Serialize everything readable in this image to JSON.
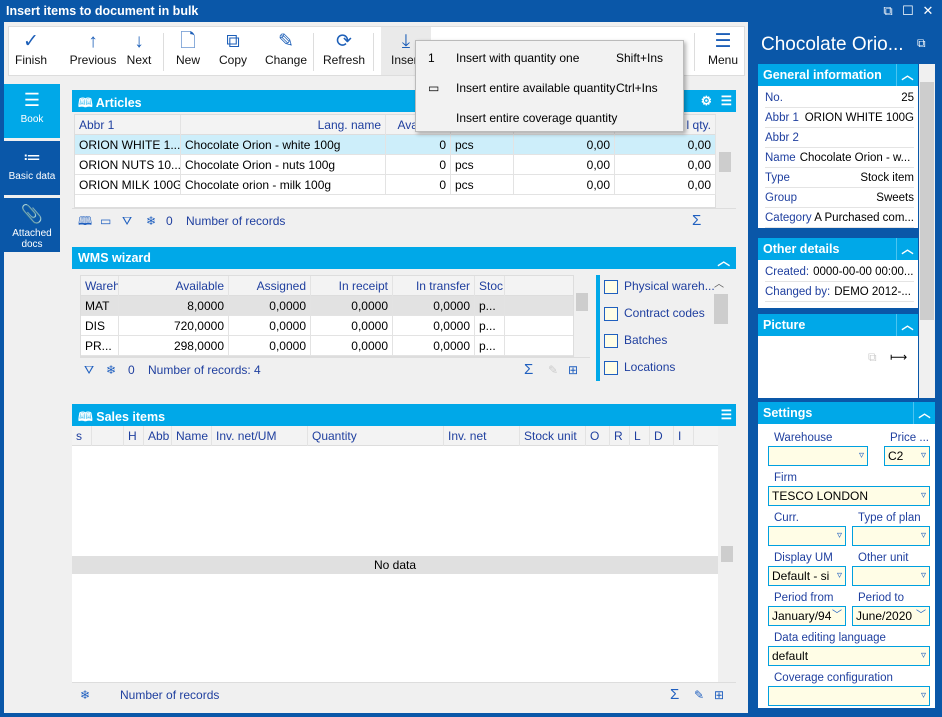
{
  "window": {
    "title": "Insert items to document in bulk"
  },
  "toolbar": {
    "buttons": [
      {
        "label": "Finish",
        "icon": "✓"
      },
      {
        "label": "Previous",
        "icon": "↑"
      },
      {
        "label": "Next",
        "icon": "↓"
      },
      {
        "label": "New",
        "icon": "🗋"
      },
      {
        "label": "Copy",
        "icon": "⧉"
      },
      {
        "label": "Change",
        "icon": "✎"
      },
      {
        "label": "Refresh",
        "icon": "⟳"
      },
      {
        "label": "Insert",
        "icon": "⤓"
      }
    ],
    "menu_label": "Menu"
  },
  "insert_menu": [
    {
      "icon": "1",
      "label": "Insert with quantity one",
      "shortcut": "Shift+Ins"
    },
    {
      "icon": "▭",
      "label": "Insert entire available quantity",
      "shortcut": "Ctrl+Ins"
    },
    {
      "icon": "",
      "label": "Insert entire coverage quantity",
      "shortcut": ""
    }
  ],
  "nav": [
    {
      "label": "Book",
      "icon": "☰"
    },
    {
      "label": "Basic data",
      "icon": "≔"
    },
    {
      "label": "Attached docs",
      "icon": "📎"
    }
  ],
  "articles": {
    "title": "Articles",
    "columns": [
      "Abbr 1",
      "Lang. name",
      "Available",
      "",
      "",
      "l qty."
    ],
    "rows": [
      [
        "ORION WHITE 1...",
        "Chocolate Orion - white 100g",
        "0",
        "pcs",
        "0,00",
        "0,00"
      ],
      [
        "ORION NUTS 10...",
        "Chocolate Orion - nuts 100g",
        "0",
        "pcs",
        "0,00",
        "0,00"
      ],
      [
        "ORION MILK 100G",
        "Chocolate orion - milk 100g",
        "0",
        "pcs",
        "0,00",
        "0,00"
      ]
    ],
    "filter_count": "0",
    "records_label": "Number of records"
  },
  "wms": {
    "title": "WMS wizard",
    "columns": [
      "Wareh",
      "Available",
      "Assigned",
      "In receipt",
      "In transfer",
      "Stoc"
    ],
    "rows": [
      [
        "MAT",
        "8,0000",
        "0,0000",
        "0,0000",
        "0,0000",
        "p..."
      ],
      [
        "DIS",
        "720,0000",
        "0,0000",
        "0,0000",
        "0,0000",
        "p..."
      ],
      [
        "PR...",
        "298,0000",
        "0,0000",
        "0,0000",
        "0,0000",
        "p..."
      ]
    ],
    "filter_count": "0",
    "records_label": "Number of records: 4",
    "options": [
      "Physical wareh...",
      "Contract codes",
      "Batches",
      "Locations"
    ]
  },
  "sales": {
    "title": "Sales items",
    "columns": [
      "s",
      "",
      "H",
      "Abb",
      "Name",
      "Inv. net/UM",
      "Quantity",
      "Inv. net",
      "Stock unit",
      "O",
      "R",
      "L",
      "D",
      "I"
    ],
    "empty": "No data",
    "filter_count": "",
    "records_label": "Number of records"
  },
  "detail": {
    "title": "Chocolate Orio...",
    "general": {
      "title": "General information",
      "fields": [
        {
          "k": "No.",
          "v": "25"
        },
        {
          "k": "Abbr 1",
          "v": "ORION WHITE 100G"
        },
        {
          "k": "Abbr 2",
          "v": ""
        },
        {
          "k": "Name",
          "v": "Chocolate Orion - w..."
        },
        {
          "k": "Type",
          "v": "Stock item"
        },
        {
          "k": "Group",
          "v": "Sweets"
        },
        {
          "k": "Category",
          "v": "A Purchased com..."
        }
      ]
    },
    "other": {
      "title": "Other details",
      "fields": [
        {
          "k": "Created:",
          "v": "0000-00-00 00:00..."
        },
        {
          "k": "Changed by:",
          "v": "DEMO 2012-..."
        }
      ]
    },
    "picture": {
      "title": "Picture"
    },
    "settings": {
      "title": "Settings",
      "warehouse_label": "Warehouse",
      "warehouse": "",
      "price_label": "Price ...",
      "price": "C2",
      "firm_label": "Firm",
      "firm": "TESCO LONDON",
      "curr_label": "Curr.",
      "curr": "",
      "plan_label": "Type of plan",
      "plan": "",
      "um_label": "Display UM",
      "um": "Default - si",
      "other_unit_label": "Other unit",
      "other_unit": "",
      "from_label": "Period from",
      "from": "January/94",
      "to_label": "Period to",
      "to": "June/2020",
      "lang_label": "Data editing language",
      "lang": "default",
      "coverage_label": "Coverage configuration",
      "coverage": ""
    }
  }
}
